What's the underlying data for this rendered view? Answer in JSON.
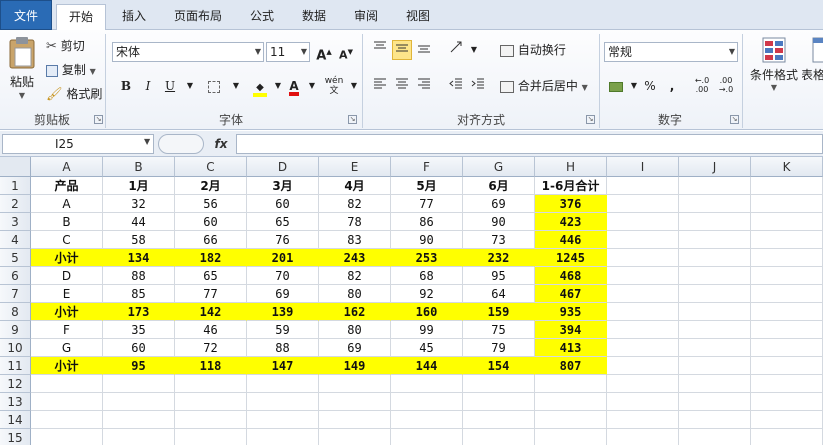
{
  "tabs": [
    "文件",
    "开始",
    "插入",
    "页面布局",
    "公式",
    "数据",
    "审阅",
    "视图"
  ],
  "active_tab_index": 1,
  "ribbon": {
    "clipboard": {
      "paste": "粘贴",
      "cut": "剪切",
      "copy": "复制",
      "format_painter": "格式刷",
      "label": "剪贴板"
    },
    "font": {
      "name": "宋体",
      "size": "11",
      "label": "字体"
    },
    "alignment": {
      "wrap": "自动换行",
      "merge": "合并后居中",
      "label": "对齐方式"
    },
    "number": {
      "format": "常规",
      "percent": "%",
      "comma": ",",
      "label": "数字"
    },
    "styles": {
      "conditional": "条件格式",
      "table_fragment": "表格式"
    }
  },
  "formula_bar": {
    "name_box": "I25",
    "fx": "fx",
    "content": ""
  },
  "grid": {
    "columns": [
      "A",
      "B",
      "C",
      "D",
      "E",
      "F",
      "G",
      "H",
      "I",
      "J",
      "K"
    ],
    "row_numbers": [
      "1",
      "2",
      "3",
      "4",
      "5",
      "6",
      "7",
      "8",
      "9",
      "10",
      "11",
      "12",
      "13",
      "14",
      "15"
    ],
    "highlight_color": "#ffff00",
    "rows": [
      {
        "cells": [
          "产品",
          "1月",
          "2月",
          "3月",
          "4月",
          "5月",
          "6月",
          "1-6月合计"
        ],
        "header": true
      },
      {
        "cells": [
          "A",
          "32",
          "56",
          "60",
          "82",
          "77",
          "69",
          "376"
        ]
      },
      {
        "cells": [
          "B",
          "44",
          "60",
          "65",
          "78",
          "86",
          "90",
          "423"
        ]
      },
      {
        "cells": [
          "C",
          "58",
          "66",
          "76",
          "83",
          "90",
          "73",
          "446"
        ]
      },
      {
        "cells": [
          "小计",
          "134",
          "182",
          "201",
          "243",
          "253",
          "232",
          "1245"
        ],
        "subtotal": true
      },
      {
        "cells": [
          "D",
          "88",
          "65",
          "70",
          "82",
          "68",
          "95",
          "468"
        ]
      },
      {
        "cells": [
          "E",
          "85",
          "77",
          "69",
          "80",
          "92",
          "64",
          "467"
        ]
      },
      {
        "cells": [
          "小计",
          "173",
          "142",
          "139",
          "162",
          "160",
          "159",
          "935"
        ],
        "subtotal": true
      },
      {
        "cells": [
          "F",
          "35",
          "46",
          "59",
          "80",
          "99",
          "75",
          "394"
        ]
      },
      {
        "cells": [
          "G",
          "60",
          "72",
          "88",
          "69",
          "45",
          "79",
          "413"
        ]
      },
      {
        "cells": [
          "小计",
          "95",
          "118",
          "147",
          "149",
          "144",
          "154",
          "807"
        ],
        "subtotal": true
      }
    ]
  }
}
